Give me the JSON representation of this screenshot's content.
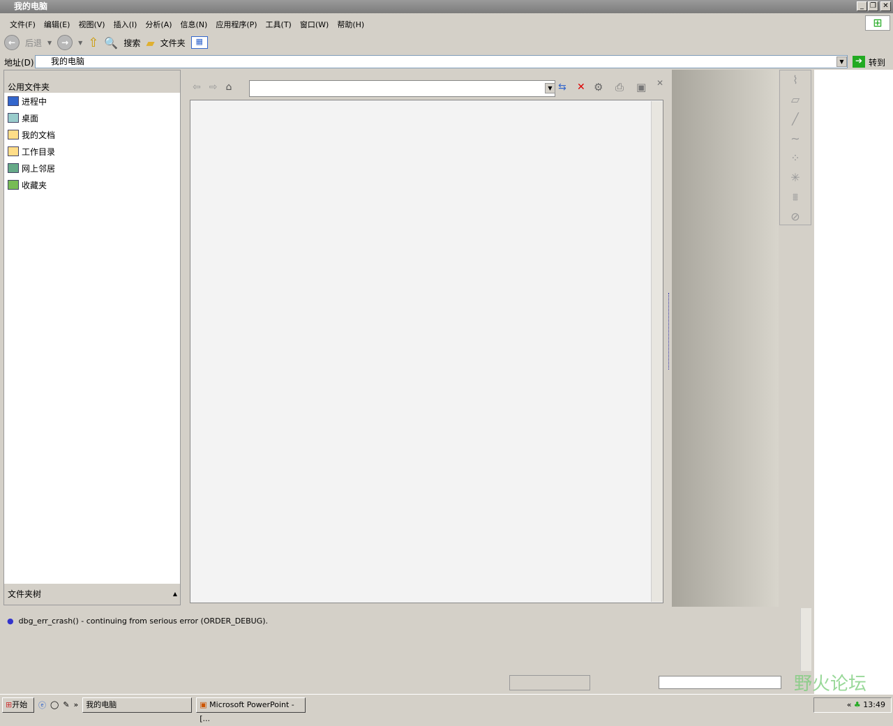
{
  "window": {
    "title": "我的电脑"
  },
  "menu": [
    "文件(F)",
    "编辑(E)",
    "视图(V)",
    "插入(I)",
    "分析(A)",
    "信息(N)",
    "应用程序(P)",
    "工具(T)",
    "窗口(W)",
    "帮助(H)"
  ],
  "toolbar": {
    "back": "后退",
    "search": "搜索",
    "folders": "文件夹"
  },
  "address": {
    "label": "地址(D)",
    "value": "我的电脑",
    "go": "转到"
  },
  "left_panel": {
    "header": "公用文件夹",
    "items": [
      "进程中",
      "桌面",
      "我的文档",
      "工作目录",
      "网上邻居",
      "收藏夹"
    ],
    "footer": "文件夹树"
  },
  "message": "dbg_err_crash() - continuing from serious error (ORDER_DEBUG).",
  "watermark": "野火论坛",
  "taskbar": {
    "start": "开始",
    "tasks": [
      "我的电脑",
      "Microsoft PowerPoint - [..."
    ],
    "clock": "13:49"
  }
}
